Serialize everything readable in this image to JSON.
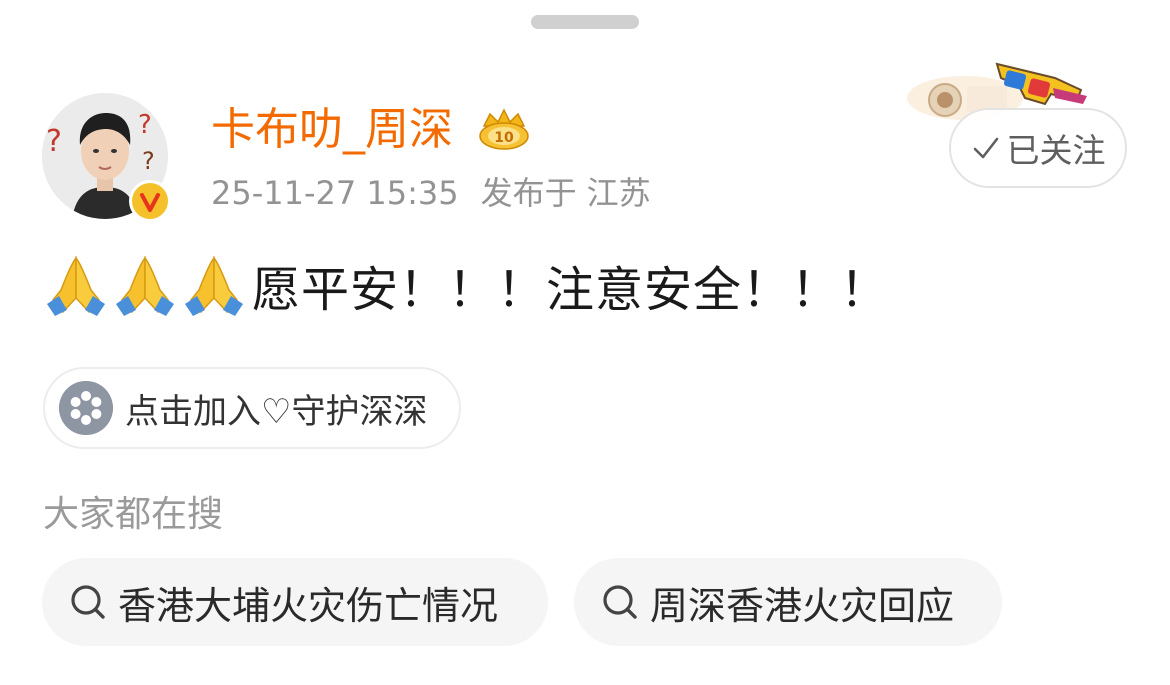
{
  "post": {
    "author": {
      "name": "卡布叻_周深",
      "verified": true
    },
    "date": "25-11-27 15:35",
    "location_prefix": "发布于",
    "location": "江苏",
    "follow_label": "已关注",
    "text": "愿平安！！！注意安全！！！",
    "emoji": "folded-hands"
  },
  "supergroup_chip": {
    "label": "点击加入♡守护深深",
    "icon": "flower-icon"
  },
  "trending": {
    "title": "大家都在搜",
    "items": [
      "香港大埔火灾伤亡情况",
      "周深香港火灾回应"
    ]
  },
  "colors": {
    "username": "#f26a00",
    "verified_badge": "#f5c12b",
    "meta_text": "#939393"
  }
}
